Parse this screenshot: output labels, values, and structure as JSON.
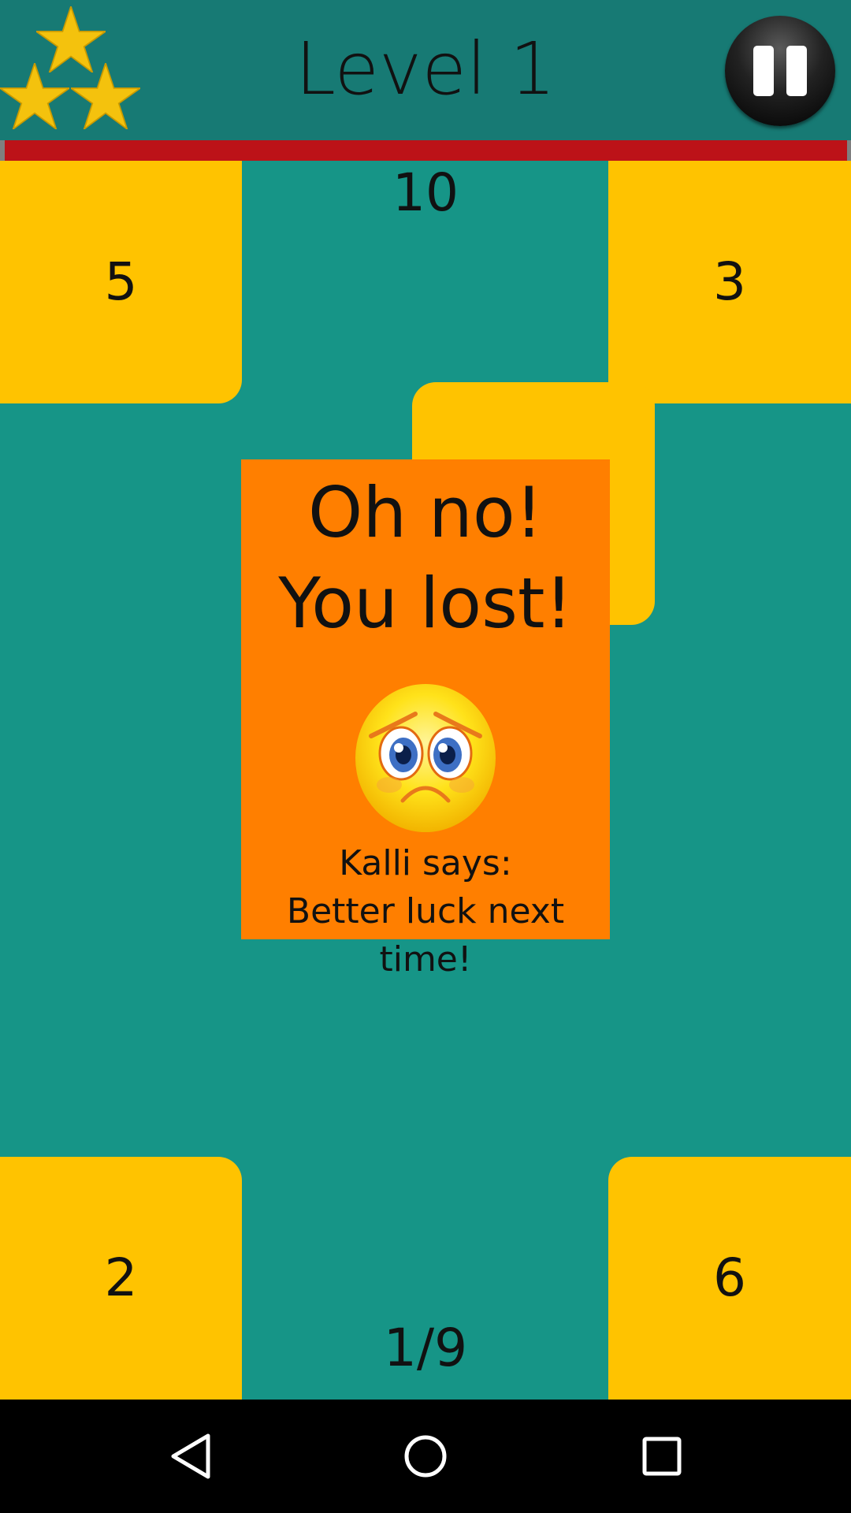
{
  "header": {
    "title": "Level 1",
    "stars_earned": 3,
    "star_color": "#F4C20D",
    "pause_icon": "pause-icon"
  },
  "timer": {
    "remaining_fraction": 0.995,
    "color": "#BC1218"
  },
  "board": {
    "target": "10",
    "progress": "1/9",
    "tile_color": "#FFC300",
    "tiles": {
      "top_left": "5",
      "top_right": "3",
      "bottom_left": "2",
      "bottom_right": "6"
    }
  },
  "popup": {
    "title_line1": "Oh no!",
    "title_line2": "You lost!",
    "face_icon": "sad-face-icon",
    "message_line1": "Kalli says:",
    "message_line2": "Better luck next time!",
    "background": "#FF7F00"
  },
  "navbar": {
    "back_icon": "back-triangle-icon",
    "home_icon": "home-circle-icon",
    "recents_icon": "recents-square-icon"
  }
}
